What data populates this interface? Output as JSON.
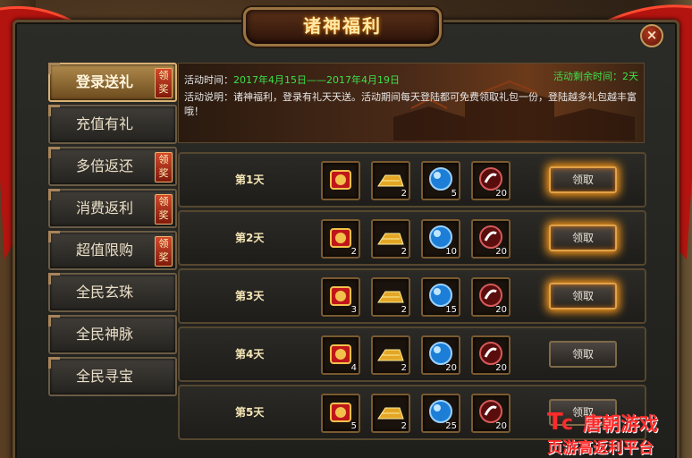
{
  "title": "诸神福利",
  "close_symbol": "×",
  "sidebar": {
    "items": [
      {
        "label": "登录送礼",
        "badge": "领奖",
        "active": true
      },
      {
        "label": "充值有礼",
        "badge": ""
      },
      {
        "label": "多倍返还",
        "badge": "领奖"
      },
      {
        "label": "消费返利",
        "badge": "领奖"
      },
      {
        "label": "超值限购",
        "badge": "领奖"
      },
      {
        "label": "全民玄珠",
        "badge": ""
      },
      {
        "label": "全民神脉",
        "badge": ""
      },
      {
        "label": "全民寻宝",
        "badge": ""
      }
    ]
  },
  "info": {
    "time_label": "活动时间：",
    "time_value": "2017年4月15日——2017年4月19日",
    "remaining_label": "活动剩余时间：",
    "remaining_value": "2天",
    "desc_label": "活动说明：",
    "desc_value": "诸神福利，登录有礼天天送。活动期间每天登陆都可免费领取礼包一份，登陆越多礼包越丰富哦！"
  },
  "rewards": [
    {
      "day": "第1天",
      "items": [
        "",
        "2",
        "5",
        "20"
      ],
      "claim": "领取",
      "claimable": true
    },
    {
      "day": "第2天",
      "items": [
        "2",
        "2",
        "10",
        "20"
      ],
      "claim": "领取",
      "claimable": true
    },
    {
      "day": "第3天",
      "items": [
        "3",
        "2",
        "15",
        "20"
      ],
      "claim": "领取",
      "claimable": true
    },
    {
      "day": "第4天",
      "items": [
        "4",
        "2",
        "20",
        "20"
      ],
      "claim": "领取",
      "claimable": false
    },
    {
      "day": "第5天",
      "items": [
        "5",
        "2",
        "25",
        "20"
      ],
      "claim": "领取",
      "claimable": false
    }
  ],
  "item_icons": [
    "treasure-seal-icon",
    "gold-ingot-icon",
    "blue-orb-icon",
    "red-orb-icon"
  ],
  "colors": {
    "accent": "#ffe9a8",
    "highlight": "#3ee04a",
    "claim_glow": "#ff9b1a"
  },
  "watermark": {
    "line1": "唐朝游戏",
    "line2": "页游高返利平台"
  }
}
